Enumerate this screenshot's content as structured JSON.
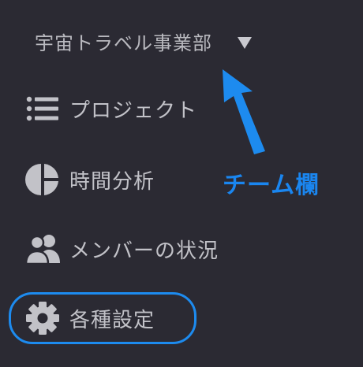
{
  "team": {
    "name": "宇宙トラベル事業部"
  },
  "nav": {
    "items": [
      {
        "label": "プロジェクト",
        "icon": "list-icon"
      },
      {
        "label": "時間分析",
        "icon": "pie-chart-icon"
      },
      {
        "label": "メンバーの状況",
        "icon": "people-icon"
      },
      {
        "label": "各種設定",
        "icon": "gear-icon"
      }
    ]
  },
  "annotation": {
    "label": "チーム欄",
    "color": "#1a86f0"
  },
  "colors": {
    "background": "#2b2a33",
    "text": "#c2c2c8",
    "accent": "#1d8bef"
  }
}
